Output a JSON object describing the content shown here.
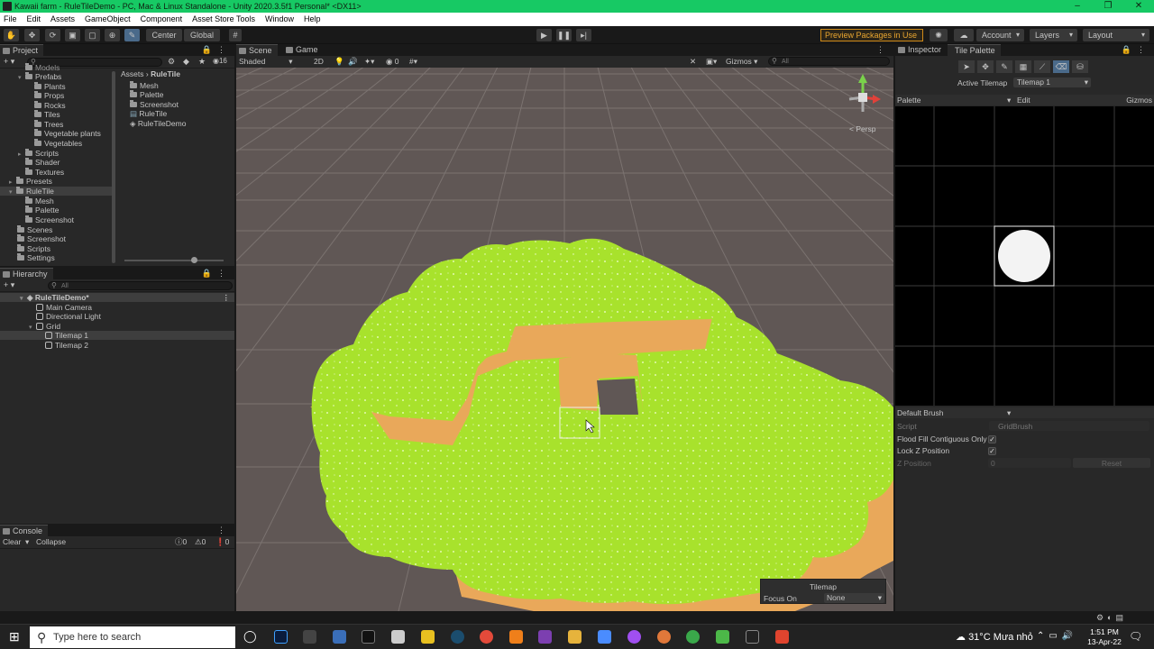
{
  "window": {
    "title": "Kawaii farm - RuleTileDemo - PC, Mac & Linux Standalone - Unity 2020.3.5f1 Personal* <DX11>"
  },
  "menu": [
    "File",
    "Edit",
    "Assets",
    "GameObject",
    "Component",
    "Asset Store Tools",
    "Window",
    "Help"
  ],
  "toolbar": {
    "center": "Center",
    "global": "Global",
    "preview": "Preview Packages in Use",
    "account": "Account",
    "layers": "Layers",
    "layout": "Layout"
  },
  "project": {
    "tab": "Project",
    "count": "16",
    "breadcrumb": [
      "Assets",
      "RuleTile"
    ],
    "tree": [
      "Models",
      "Prefabs",
      "Plants",
      "Props",
      "Rocks",
      "Tiles",
      "Trees",
      "Vegetable plants",
      "Vegetables",
      "Scripts",
      "Shader",
      "Textures",
      "Presets",
      "RuleTile",
      "Mesh",
      "Palette",
      "Screenshot",
      "Scenes",
      "Screenshot",
      "Scripts",
      "Settings"
    ],
    "files": [
      "Mesh",
      "Palette",
      "Screenshot",
      "RuleTile",
      "RuleTileDemo"
    ]
  },
  "hierarchy": {
    "tab": "Hierarchy",
    "search_placeholder": "All",
    "items": [
      "RuleTileDemo*",
      "Main Camera",
      "Directional Light",
      "Grid",
      "Tilemap 1",
      "Tilemap 2"
    ]
  },
  "console": {
    "tab": "Console",
    "clear": "Clear",
    "collapse": "Collapse",
    "counts": [
      "0",
      "0",
      "0"
    ]
  },
  "scene": {
    "tab_scene": "Scene",
    "tab_game": "Game",
    "shading": "Shaded",
    "mode2d": "2D",
    "gizmos": "Gizmos",
    "search_placeholder": "All",
    "persp": "< Persp",
    "overlay": {
      "title": "Tilemap",
      "focus_label": "Focus On",
      "focus_value": "None"
    }
  },
  "inspector": {
    "tab_inspector": "Inspector",
    "tab_palette": "Tile Palette",
    "active_tilemap_label": "Active Tilemap",
    "active_tilemap_value": "Tilemap 1",
    "palette_label": "Palette",
    "edit": "Edit",
    "gizmos": "Gizmos",
    "brush": "Default Brush",
    "script_label": "Script",
    "script_value": "GridBrush",
    "flood_fill": "Flood Fill Contiguous Only",
    "lock_z": "Lock Z Position",
    "z_position": "Z Position",
    "z_value": "0",
    "reset": "Reset"
  },
  "taskbar": {
    "search_placeholder": "Type here to search",
    "weather": "31°C  Mưa nhỏ",
    "time": "1:51 PM",
    "date": "13-Apr-22"
  },
  "colors": {
    "grass": "#a8e22c",
    "dirt": "#e9a85a",
    "scene_bg": "#605755",
    "accent": "#2c5d87"
  }
}
